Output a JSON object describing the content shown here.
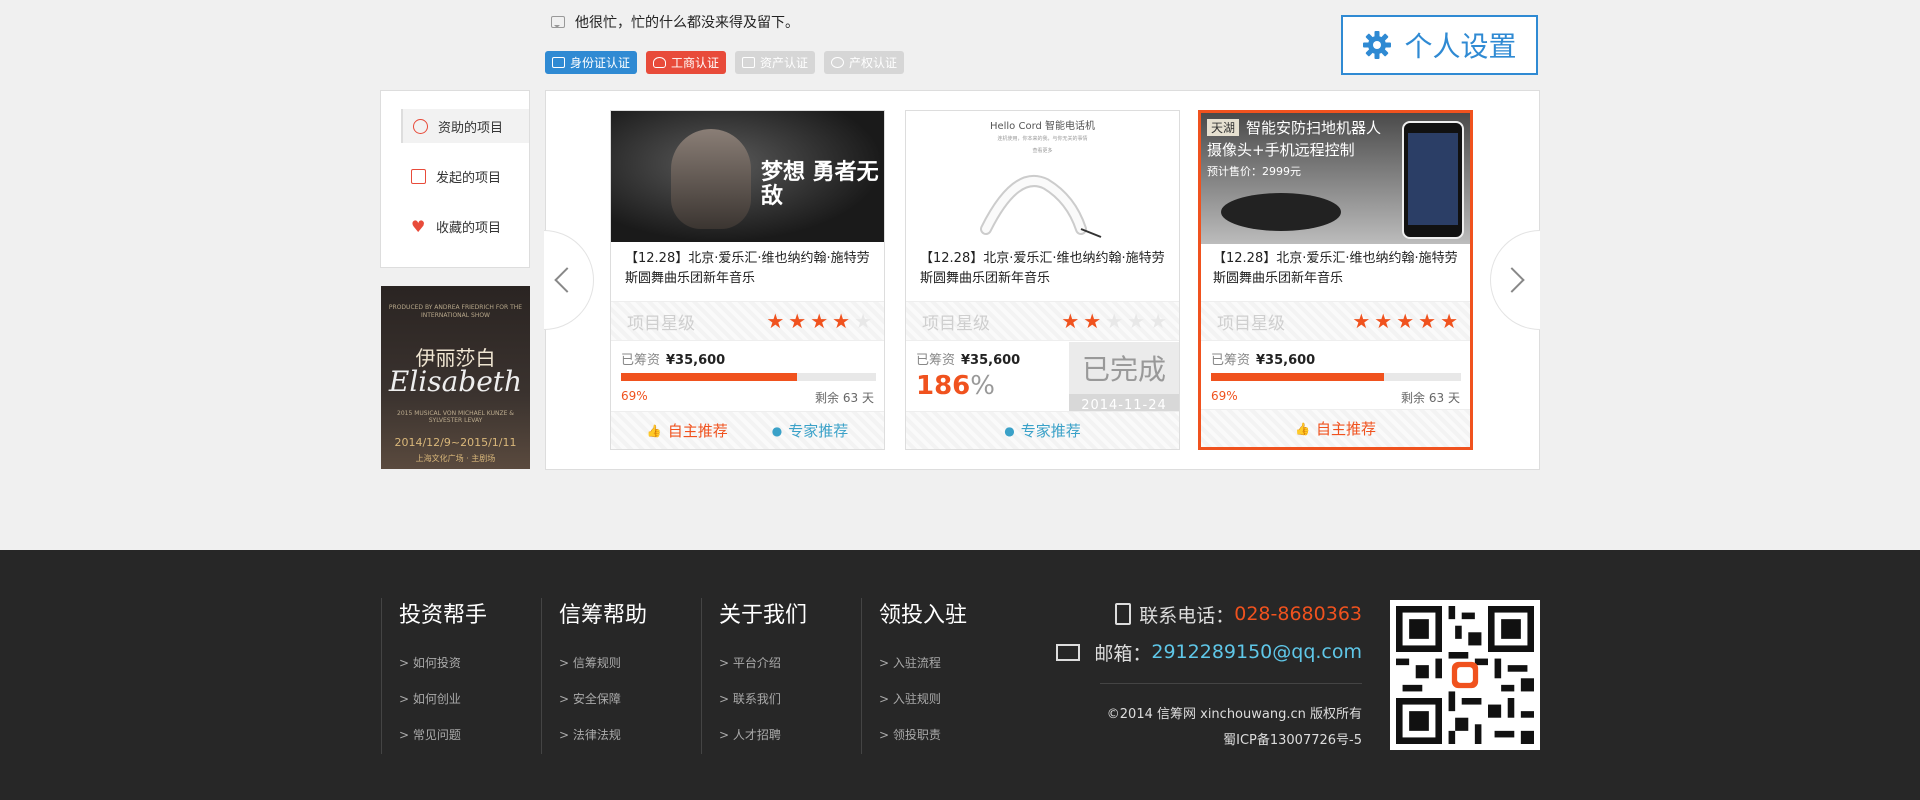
{
  "header": {
    "status_text": "他很忙，忙的什么都没来得及留下。",
    "badges": [
      {
        "label": "身份证认证",
        "color": "#2f8ad3",
        "active": true
      },
      {
        "label": "工商认证",
        "color": "#e84b3a",
        "active": true
      },
      {
        "label": "资产认证",
        "color": "#d6d6d6",
        "active": false
      },
      {
        "label": "产权认证",
        "color": "#d6d6d6",
        "active": false
      }
    ],
    "settings_label": "个人设置"
  },
  "sidebar": {
    "items": [
      {
        "label": "资助的项目",
        "icon": "coin-icon"
      },
      {
        "label": "发起的项目",
        "icon": "edit-icon"
      },
      {
        "label": "收藏的项目",
        "icon": "heart-icon"
      }
    ]
  },
  "poster": {
    "top_text": "PRODUCED BY ANDREA FRIEDRICH FOR\nTHE INTERNATIONAL SHOW",
    "title_cn": "伊丽莎白",
    "title_en": "Elisabeth",
    "sub": "2015 MUSICAL VON\nMICHAEL KUNZE & SYLVESTER LEVAY",
    "date": "2014/12/9~2015/1/11",
    "venue": "上海文化广场 · 主剧场"
  },
  "cards": [
    {
      "image_text": "梦想 勇者无敌",
      "title": "【12.28】北京·爱乐汇·维也纳约翰·施特劳斯圆舞曲乐团新年音乐",
      "rating_label": "项目星级",
      "stars": 4,
      "raised_label": "已筹资",
      "raised_value": "¥35,600",
      "percent": 69,
      "percent_suffix": "%",
      "remain_label": "剩余",
      "remain_days": "63",
      "remain_unit": "天",
      "self_label": "自主推荐",
      "expert_label": "专家推荐"
    },
    {
      "image_text_title": "Hello Cord 智能电话机",
      "image_text_sub": "连机使用，你本来的我，与你无关的事情",
      "image_text_more": "查看更多",
      "title": "【12.28】北京·爱乐汇·维也纳约翰·施特劳斯圆舞曲乐团新年音乐",
      "rating_label": "项目星级",
      "stars": 2,
      "raised_label": "已筹资",
      "raised_value": "¥35,600",
      "percent_big": "186",
      "percent_suffix": "%",
      "done_label": "已完成",
      "done_date": "2014-11-24",
      "expert_label": "专家推荐"
    },
    {
      "image_tag": "天湖",
      "image_title": "智能安防扫地机器人",
      "image_sub": "摄像头+手机远程控制",
      "image_price": "预计售价：2999元",
      "title": "【12.28】北京·爱乐汇·维也纳约翰·施特劳斯圆舞曲乐团新年音乐",
      "rating_label": "项目星级",
      "stars": 5,
      "raised_label": "已筹资",
      "raised_value": "¥35,600",
      "percent": 69,
      "percent_suffix": "%",
      "remain_label": "剩余",
      "remain_days": "63",
      "remain_unit": "天",
      "self_label": "自主推荐"
    }
  ],
  "footer": {
    "columns": [
      {
        "title": "投资帮手",
        "links": [
          "> 如何投资",
          "> 如何创业",
          "> 常见问题"
        ]
      },
      {
        "title": "信筹帮助",
        "links": [
          "> 信筹规则",
          "> 安全保障",
          "> 法律法规"
        ]
      },
      {
        "title": "关于我们",
        "links": [
          "> 平台介绍",
          "> 联系我们",
          "> 人才招聘"
        ]
      },
      {
        "title": "领投入驻",
        "links": [
          "> 入驻流程",
          "> 入驻规则",
          "> 领投职责"
        ]
      }
    ],
    "phone_label": "联系电话：",
    "phone": "028-8680363",
    "email_label": "邮箱：",
    "email": "2912289150@qq.com",
    "copyright": "©2014 信筹网 xinchouwang.cn 版权所有",
    "icp": "蜀ICP备13007726号-5"
  },
  "colors": {
    "accent": "#f0521e",
    "blue": "#2f8ad3",
    "teal": "#3aa1c8",
    "footer_bg": "#272727"
  }
}
